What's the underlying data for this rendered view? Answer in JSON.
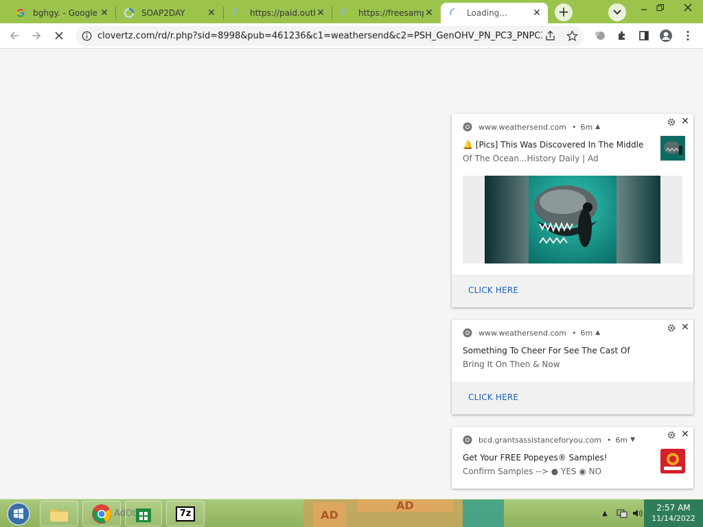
{
  "tabs": [
    {
      "title": "bghgy. - Google",
      "favicon": "google-g-icon"
    },
    {
      "title": "SOAP2DAY",
      "favicon": "spinner-icon"
    },
    {
      "title": "https://paid.outb",
      "favicon": "spinner-icon"
    },
    {
      "title": "https://freesampl",
      "favicon": "spinner-icon"
    },
    {
      "title": "Loading...",
      "favicon": "spinner-icon",
      "active": true
    }
  ],
  "toolbar": {
    "url": "clovertz.com/rd/r.php?sid=8998&pub=461236&c1=weathersend&c2=PSH_GenOHV_PN_PC3_PNPC3_..."
  },
  "notifications": [
    {
      "source": "www.weathersend.com",
      "time": "6m",
      "title": "🔔 [Pics] This Was Discovered In The Middle",
      "body": "Of The Ocean...History Daily | Ad",
      "action": "CLICK HERE"
    },
    {
      "source": "www.weathersend.com",
      "time": "6m",
      "title": "Something To Cheer For See The Cast Of",
      "body": "Bring It On Then & Now",
      "action": "CLICK HERE"
    },
    {
      "source": "bcd.grantsassistanceforyou.com",
      "time": "6m",
      "title": "Get Your FREE Popeyes® Samples!",
      "body": "Confirm Samples --> ● YES ◉ NO"
    }
  ],
  "taskbar": {
    "ad_label_1": "AD",
    "ad_label_2": "AD",
    "sevenzip_label": "7z",
    "adobe_label": "AdObe"
  },
  "clock": {
    "time": "2:57 AM",
    "date": "11/14/2022"
  },
  "colors": {
    "tab_strip": "#9cc44d",
    "cta_link": "#1a5fb4",
    "clock_bg": "#2f7d58"
  }
}
